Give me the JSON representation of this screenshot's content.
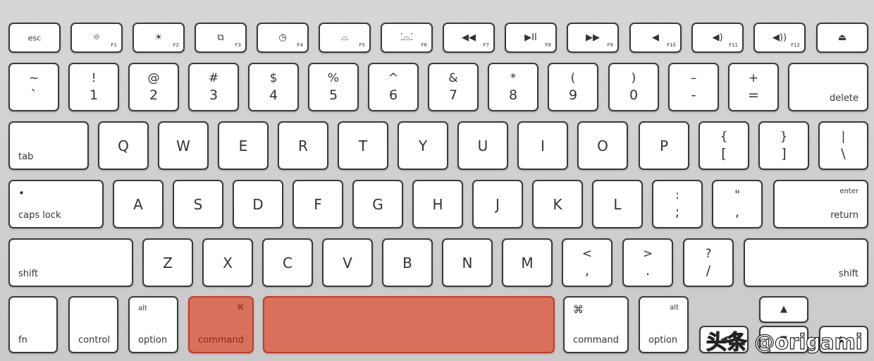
{
  "function_row": [
    {
      "label": "esc"
    },
    {
      "icon": "brightness-down-icon",
      "glyph": "☼",
      "fn": "F1"
    },
    {
      "icon": "brightness-up-icon",
      "glyph": "☀",
      "fn": "F2"
    },
    {
      "icon": "expose-icon",
      "glyph": "⧉",
      "fn": "F3"
    },
    {
      "icon": "dashboard-icon",
      "glyph": "◷",
      "fn": "F4"
    },
    {
      "icon": "keyboard-light-down-icon",
      "glyph": "⌓",
      "fn": "F5"
    },
    {
      "icon": "keyboard-light-up-icon",
      "glyph": "⁚⌓⁚",
      "fn": "F6"
    },
    {
      "icon": "rewind-icon",
      "glyph": "◀◀",
      "fn": "F7"
    },
    {
      "icon": "play-pause-icon",
      "glyph": "▶II",
      "fn": "F8"
    },
    {
      "icon": "fast-forward-icon",
      "glyph": "▶▶",
      "fn": "F9"
    },
    {
      "icon": "mute-icon",
      "glyph": "◀",
      "fn": "F10"
    },
    {
      "icon": "volume-down-icon",
      "glyph": "◀)",
      "fn": "F11"
    },
    {
      "icon": "volume-up-icon",
      "glyph": "◀))",
      "fn": "F12"
    },
    {
      "icon": "eject-icon",
      "glyph": "⏏"
    }
  ],
  "number_row": [
    {
      "top": "~",
      "bottom": "`"
    },
    {
      "top": "!",
      "bottom": "1"
    },
    {
      "top": "@",
      "bottom": "2"
    },
    {
      "top": "#",
      "bottom": "3"
    },
    {
      "top": "$",
      "bottom": "4"
    },
    {
      "top": "%",
      "bottom": "5"
    },
    {
      "top": "^",
      "bottom": "6"
    },
    {
      "top": "&",
      "bottom": "7"
    },
    {
      "top": "*",
      "bottom": "8"
    },
    {
      "top": "(",
      "bottom": "9"
    },
    {
      "top": ")",
      "bottom": "0"
    },
    {
      "top": "–",
      "bottom": "-"
    },
    {
      "top": "+",
      "bottom": "="
    },
    {
      "br": "delete"
    }
  ],
  "qwerty_row": [
    {
      "bl": "tab"
    },
    {
      "mid": "Q"
    },
    {
      "mid": "W"
    },
    {
      "mid": "E"
    },
    {
      "mid": "R"
    },
    {
      "mid": "T"
    },
    {
      "mid": "Y"
    },
    {
      "mid": "U"
    },
    {
      "mid": "I"
    },
    {
      "mid": "O"
    },
    {
      "mid": "P"
    },
    {
      "top": "{",
      "bottom": "["
    },
    {
      "top": "}",
      "bottom": "]"
    },
    {
      "top": "|",
      "bottom": "\\"
    }
  ],
  "home_row": [
    {
      "bl": "caps lock",
      "tl": "•"
    },
    {
      "mid": "A"
    },
    {
      "mid": "S"
    },
    {
      "mid": "D"
    },
    {
      "mid": "F"
    },
    {
      "mid": "G"
    },
    {
      "mid": "H"
    },
    {
      "mid": "J"
    },
    {
      "mid": "K"
    },
    {
      "mid": "L"
    },
    {
      "top": ":",
      "bottom": ";"
    },
    {
      "top": "\"",
      "bottom": ","
    },
    {
      "tr": "enter",
      "br": "return"
    }
  ],
  "shift_row": [
    {
      "bl": "shift"
    },
    {
      "mid": "Z"
    },
    {
      "mid": "X"
    },
    {
      "mid": "C"
    },
    {
      "mid": "V"
    },
    {
      "mid": "B"
    },
    {
      "mid": "N"
    },
    {
      "mid": "M"
    },
    {
      "top": "<",
      "bottom": ","
    },
    {
      "top": ">",
      "bottom": "."
    },
    {
      "top": "?",
      "bottom": "/"
    },
    {
      "br": "shift"
    }
  ],
  "bottom_row": [
    {
      "bl": "fn"
    },
    {
      "bl": "control"
    },
    {
      "bl": "option",
      "tl": "alt"
    },
    {
      "bl": "command",
      "tr": "⌘",
      "highlighted": true
    },
    {
      "highlighted": true
    },
    {
      "bl": "command",
      "tl": "⌘"
    },
    {
      "bl": "option",
      "tr": "alt"
    },
    {
      "glyph": "◀",
      "icon": "arrow-left-icon"
    },
    {
      "glyph": "▲",
      "icon": "arrow-up-icon"
    },
    {
      "glyph": "▼",
      "icon": "arrow-down-icon"
    },
    {
      "glyph": "▶",
      "icon": "arrow-right-icon"
    }
  ],
  "highlight_color": "#d9705b",
  "watermark": "头条 @origami"
}
